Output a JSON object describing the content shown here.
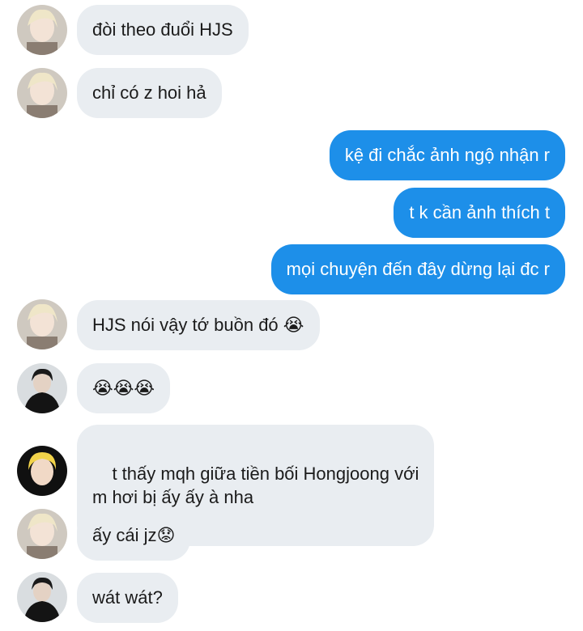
{
  "messages": [
    {
      "side": "in",
      "avatar": "blonde-user",
      "text": "đòi theo đuổi HJS",
      "emoji": ""
    },
    {
      "side": "in",
      "avatar": "blonde-user",
      "text": "chỉ có z hoi hả",
      "emoji": ""
    },
    {
      "side": "out",
      "text": "kệ đi chắc ảnh ngộ nhận r"
    },
    {
      "side": "out",
      "text": "t k cần ảnh thích t"
    },
    {
      "side": "out",
      "text": "mọi chuyện đến đây dừng lại đc r"
    },
    {
      "side": "in",
      "avatar": "blonde-user",
      "text": "HJS nói vậy tớ buồn đó ",
      "emoji": "😭"
    },
    {
      "side": "in",
      "avatar": "dark-user",
      "text": "",
      "emoji": "😭😭😭"
    },
    {
      "side": "in",
      "avatar": "curly-user",
      "text": "t thấy mqh giữa tiền bối Hongjoong với\nm hơi bị ấy ấy à nha",
      "emoji": ""
    },
    {
      "side": "in",
      "avatar": "blonde-user",
      "text": "ấy cái jz",
      "emoji": "😟"
    },
    {
      "side": "in",
      "avatar": "dark-user",
      "text": "wát wát?",
      "emoji": ""
    }
  ],
  "colors": {
    "incoming_bubble": "#e9edf1",
    "outgoing_bubble": "#1d8fe9"
  }
}
